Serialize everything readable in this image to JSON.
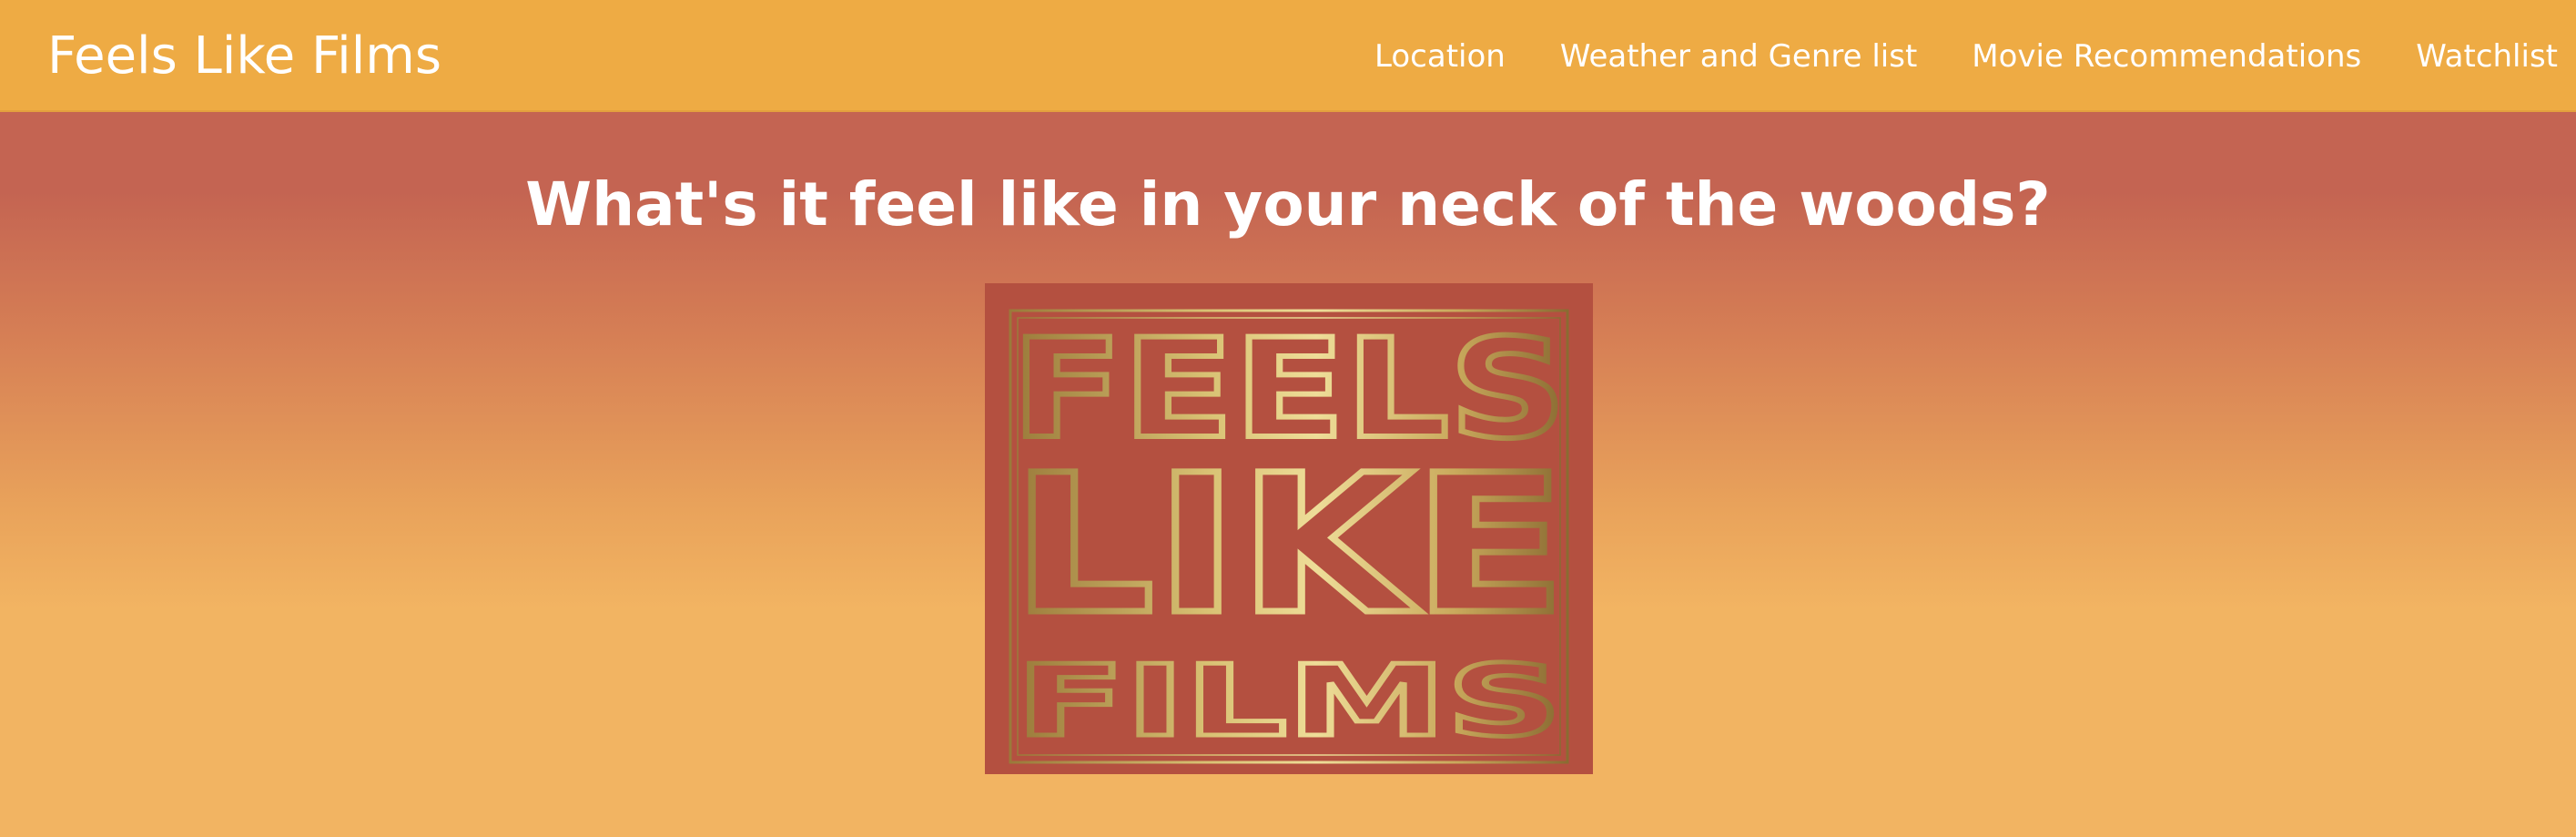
{
  "navbar": {
    "brand": "Feels Like Films",
    "links": [
      {
        "label": "Location"
      },
      {
        "label": "Weather and Genre list"
      },
      {
        "label": "Movie Recommendations"
      },
      {
        "label": "Watchlist"
      }
    ]
  },
  "main": {
    "heading": "What's it feel like in your neck of the woods?",
    "logo": {
      "line1": "FEELS",
      "line2": "LIKE",
      "line3": "FILMS"
    }
  },
  "colors": {
    "navbar_bg": "#eeab44",
    "background_top": "#c46452",
    "background_bottom": "#f2b462",
    "logo_bg": "#b45040",
    "logo_gold": "#d8c173",
    "text": "#ffffff"
  }
}
